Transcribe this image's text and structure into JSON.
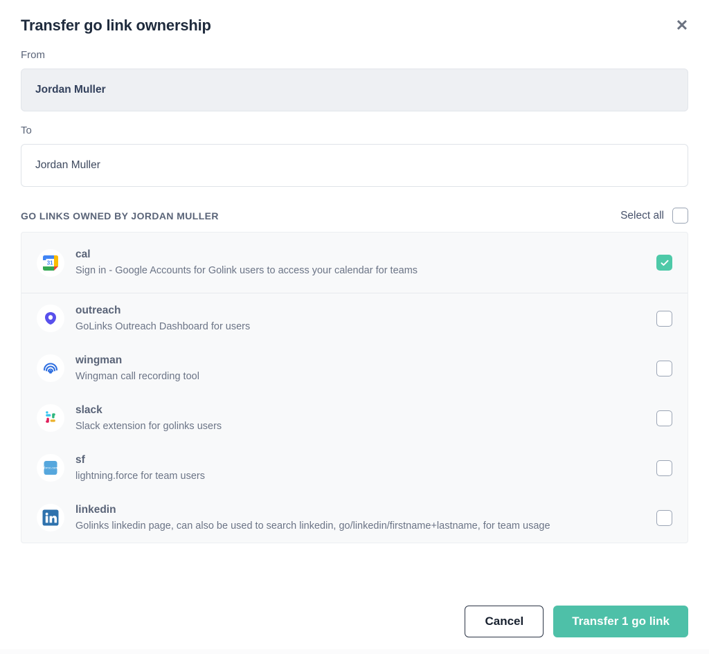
{
  "modal": {
    "title": "Transfer go link ownership",
    "close_icon": "close-icon"
  },
  "form": {
    "from_label": "From",
    "from_value": "Jordan Muller",
    "to_label": "To",
    "to_value": "Jordan Muller",
    "to_placeholder": "Jordan Muller"
  },
  "list": {
    "title": "GO LINKS OWNED BY JORDAN MULLER",
    "select_all_label": "Select all",
    "select_all_checked": false,
    "rows": [
      {
        "name": "cal",
        "description": "Sign in - Google Accounts for Golink users to access your calendar for teams",
        "icon": "google-calendar-icon",
        "checked": true
      },
      {
        "name": "outreach",
        "description": "GoLinks Outreach Dashboard for users",
        "icon": "outreach-icon",
        "checked": false
      },
      {
        "name": "wingman",
        "description": "Wingman call recording tool",
        "icon": "wingman-icon",
        "checked": false
      },
      {
        "name": "slack",
        "description": "Slack extension for golinks users",
        "icon": "slack-icon",
        "checked": false
      },
      {
        "name": "sf",
        "description": "lightning.force for team users",
        "icon": "salesforce-icon",
        "checked": false
      },
      {
        "name": "linkedin",
        "description": "Golinks linkedin page, can also be used to search linkedin, go/linkedin/firstname+lastname, for team usage",
        "icon": "linkedin-icon",
        "checked": false
      }
    ]
  },
  "footer": {
    "cancel_label": "Cancel",
    "transfer_label": "Transfer 1 go link"
  },
  "colors": {
    "accent": "#4ec0a8",
    "checkbox_checked": "#4ec9a8",
    "title_text": "#1f2b3d",
    "body_text": "#5a6478",
    "list_bg": "#f8f9fa"
  }
}
